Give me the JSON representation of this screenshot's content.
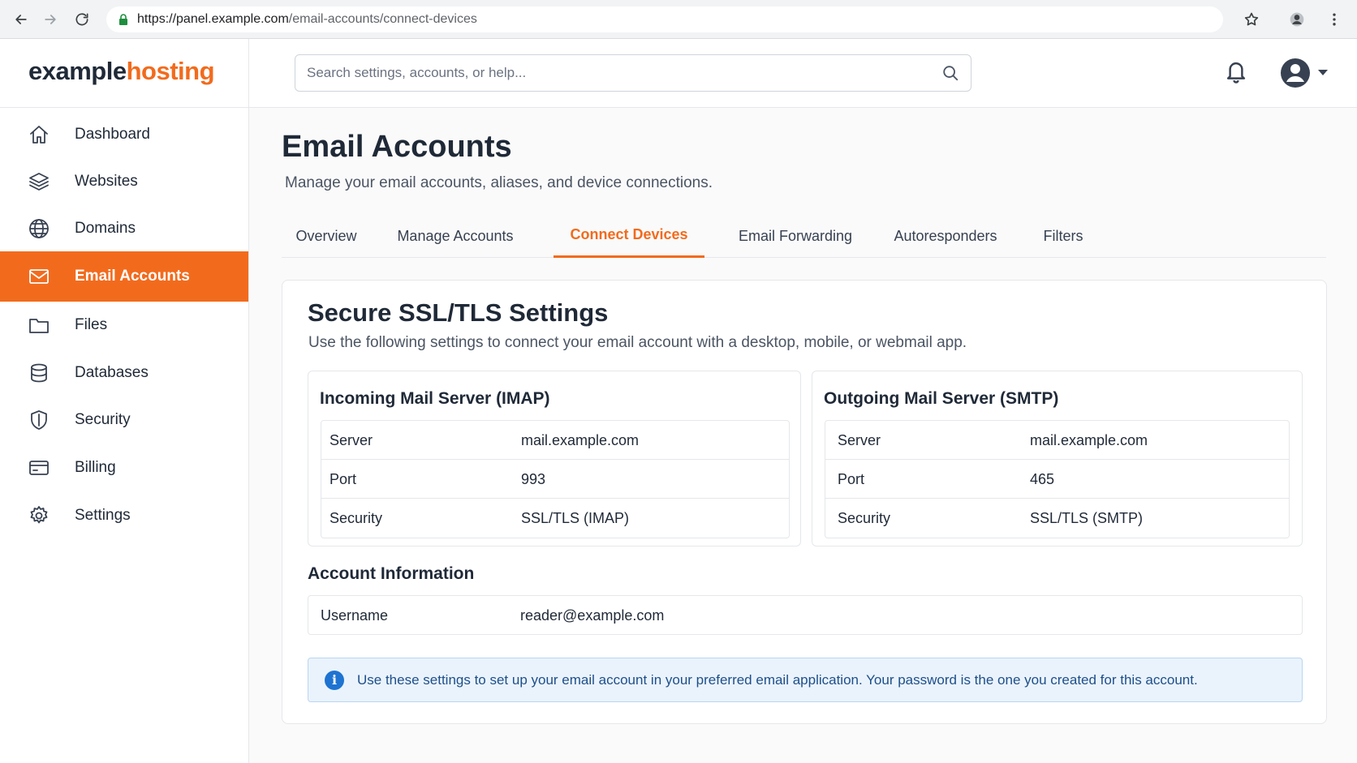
{
  "browser": {
    "url_host": "https://panel.example.com",
    "url_path": "/email-accounts/connect-devices"
  },
  "header": {
    "logo_part1": "example",
    "logo_part2": "hosting",
    "search_placeholder": "Search settings, accounts, or help..."
  },
  "sidebar": {
    "items": [
      {
        "label": "Dashboard",
        "icon": "home-icon"
      },
      {
        "label": "Websites",
        "icon": "layers-icon"
      },
      {
        "label": "Domains",
        "icon": "globe-icon"
      },
      {
        "label": "Email Accounts",
        "icon": "mail-icon",
        "active": true
      },
      {
        "label": "Files",
        "icon": "folder-icon"
      },
      {
        "label": "Databases",
        "icon": "database-icon"
      },
      {
        "label": "Security",
        "icon": "shield-icon"
      },
      {
        "label": "Billing",
        "icon": "credit-card-icon"
      },
      {
        "label": "Settings",
        "icon": "gear-icon"
      }
    ]
  },
  "page": {
    "title": "Email Accounts",
    "subtitle": "Manage your email accounts, aliases, and device connections."
  },
  "tabs": [
    {
      "label": "Overview"
    },
    {
      "label": "Manage Accounts"
    },
    {
      "label": "Connect Devices",
      "active": true
    },
    {
      "label": "Email Forwarding"
    },
    {
      "label": "Autoresponders"
    },
    {
      "label": "Filters"
    }
  ],
  "card": {
    "title": "Secure SSL/TLS Settings",
    "subtitle": "Use the following settings to connect your email account with a desktop, mobile, or webmail app.",
    "incoming": {
      "title": "Incoming Mail Server (IMAP)",
      "rows": [
        {
          "key": "Server",
          "value": "mail.example.com"
        },
        {
          "key": "Port",
          "value": "993"
        },
        {
          "key": "Security",
          "value": "SSL/TLS (IMAP)"
        }
      ]
    },
    "outgoing": {
      "title": "Outgoing Mail Server (SMTP)",
      "rows": [
        {
          "key": "Server",
          "value": "mail.example.com"
        },
        {
          "key": "Port",
          "value": "465"
        },
        {
          "key": "Security",
          "value": "SSL/TLS (SMTP)"
        }
      ]
    },
    "account": {
      "title": "Account Information",
      "username_label": "Username",
      "username_value": "reader@example.com"
    },
    "info_text": "Use these settings to set up your email account in your preferred email application. Your password is the one you created for this account."
  },
  "colors": {
    "accent": "#f26b1d",
    "info_bg": "#eaf3fc",
    "info_text": "#1e4f8a"
  }
}
